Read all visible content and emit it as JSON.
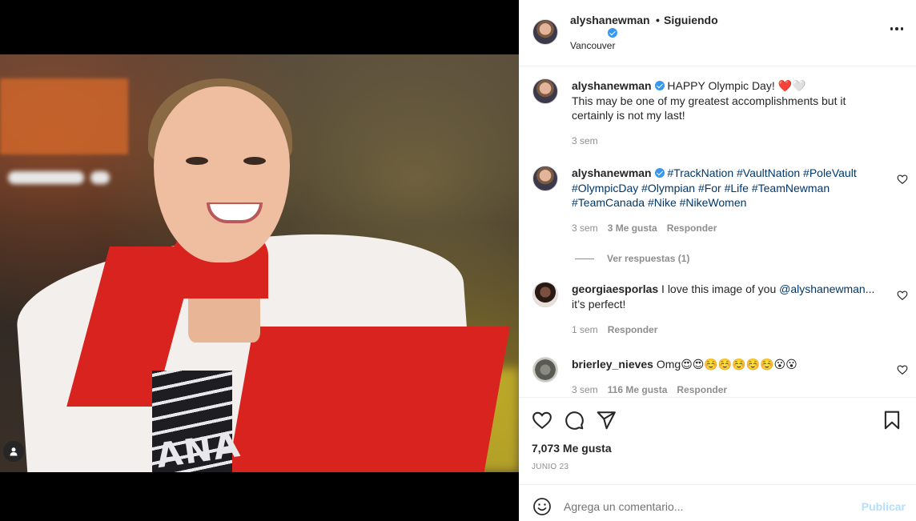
{
  "post": {
    "username": "alyshanewman",
    "separator": "•",
    "follow_status": "Siguiendo",
    "location": "Vancouver",
    "image_overlay_text": "ANA",
    "colors": {
      "verified": "#3897f0",
      "link": "#00376b",
      "publish": "#b2dffc"
    }
  },
  "comments": [
    {
      "username": "alyshanewman",
      "verified": true,
      "text_line1": "HAPPY Olympic Day! ❤️🤍",
      "text_rest": "This may be one of my greatest accomplishments but it certainly is not my last!",
      "time": "3 sem"
    },
    {
      "username": "alyshanewman",
      "verified": true,
      "hashtags": "#TrackNation #VaultNation #PoleVault #OlympicDay #Olympian #For #Life #TeamNewman #TeamCanada #Nike #NikeWomen",
      "time": "3 sem",
      "likes": "3 Me gusta",
      "reply": "Responder",
      "view_replies": "Ver respuestas (1)"
    },
    {
      "username": "georgiaesporlas",
      "text": "I love this image of you",
      "mention": "@alyshanewman",
      "text_end": "...",
      "text_line2": "it’s perfect!",
      "time": "1 sem",
      "reply": "Responder"
    },
    {
      "username": "brierley_nieves",
      "text": "Omg😍😍☺️☺️☺️☺️☺️😮😮",
      "time": "3 sem",
      "likes": "116 Me gusta",
      "reply": "Responder"
    }
  ],
  "actions": {
    "likes": "7,073 Me gusta",
    "date": "JUNIO 23"
  },
  "add_comment": {
    "placeholder": "Agrega un comentario...",
    "publish": "Publicar"
  },
  "icons": [
    "user-tag-icon",
    "more-options-icon",
    "verified-badge-icon",
    "like-heart-icon",
    "comment-icon",
    "share-icon",
    "save-bookmark-icon",
    "emoji-icon"
  ]
}
